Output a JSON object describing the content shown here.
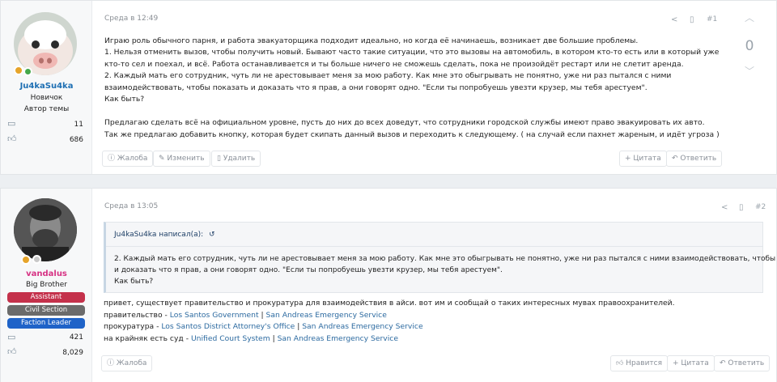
{
  "post1": {
    "username": "Ju4kaSu4ka",
    "user_title": "Новичок",
    "author_label": "Автор темы",
    "messages_count": "11",
    "reactions_count": "686",
    "timestamp": "Среда в 12:49",
    "post_number": "#1",
    "vote_score": "0",
    "lines": [
      "Играю роль обычного парня, и работа эвакуаторщика подходит идеально, но когда её начинаешь, возникает две большие проблемы.",
      "1. Нельзя отменить вызов, чтобы получить новый. Бывают часто такие ситуации, что это вызовы на автомобиль, в котором кто-то есть или в который уже",
      "кто-то сел и поехал, и всё. Работа останавливается и ты больше ничего не сможешь сделать, пока не произойдёт рестарт или не слетит аренда.",
      "2. Каждый мать его сотрудник, чуть ли не арестовывает меня за мою работу. Как мне это обыгрывать не понятно, уже ни раз пытался с ними",
      "взаимодействовать, чтобы показать и доказать что я прав, а они говорят одно. \"Если ты попробуешь увезти крузер, мы тебя арестуем\".",
      "Как быть?",
      "",
      "Предлагаю сделать всё на официальном уровне, пусть до них до всех доведут, что сотрудники городской службы имеют право эвакуировать их авто.",
      "Так же предлагаю добавить кнопку, которая будет скипать данный вызов и переходить к следующему. ( на случай если пахнет жареным, и идёт угроза )"
    ],
    "actions": {
      "report": "Жалоба",
      "edit": "Изменить",
      "delete": "Удалить",
      "quote": "+ Цитата",
      "reply": "Ответить"
    }
  },
  "post2": {
    "username": "vandalus",
    "user_title": "Big Brother",
    "roles": [
      {
        "label": "Assistant",
        "color": "#c4314b"
      },
      {
        "label": "Civil Section",
        "color": "#6b6b6b"
      },
      {
        "label": "Faction Leader",
        "color": "#1f63c8"
      }
    ],
    "messages_count": "421",
    "reactions_count": "8,029",
    "timestamp": "Среда в 13:05",
    "post_number": "#2",
    "quote_author": "Ju4kaSu4ka написал(а):",
    "quote_lines": [
      "2. Каждый мать его сотрудник, чуть ли не арестовывает меня за мою работу. Как мне это обыгрывать не понятно, уже ни раз пытался с ними взаимодействовать, чтобы показать",
      "и доказать что я прав, а они говорят одно. \"Если ты попробуешь увезти крузер, мы тебя арестуем\".",
      "Как быть?"
    ],
    "intro_line": "привет, существует правительство и прокуратура для взаимодействия в айси. вот им и сообщай о таких интересных мувах правоохранителей.",
    "govt_prefix": "правительство - ",
    "govt_link1": "Los Santos Government",
    "govt_sep": " | ",
    "govt_link2": "San Andreas Emergency Service",
    "pros_prefix": "прокуратура - ",
    "pros_link1": "Los Santos District Attorney's Office",
    "pros_sep": " | ",
    "pros_link2": "San Andreas Emergency Service",
    "court_prefix": "на крайняк есть суд - ",
    "court_link1": "Unified Court System",
    "court_sep": " | ",
    "court_link2": "San Andreas Emergency Service",
    "actions": {
      "report": "Жалоба",
      "like": "Нравится",
      "quote": "+ Цитата",
      "reply": "Ответить"
    }
  },
  "colors": {
    "username_blue": "#1e6fb3",
    "username_pink": "#d63384",
    "link": "#2c6aa0"
  }
}
